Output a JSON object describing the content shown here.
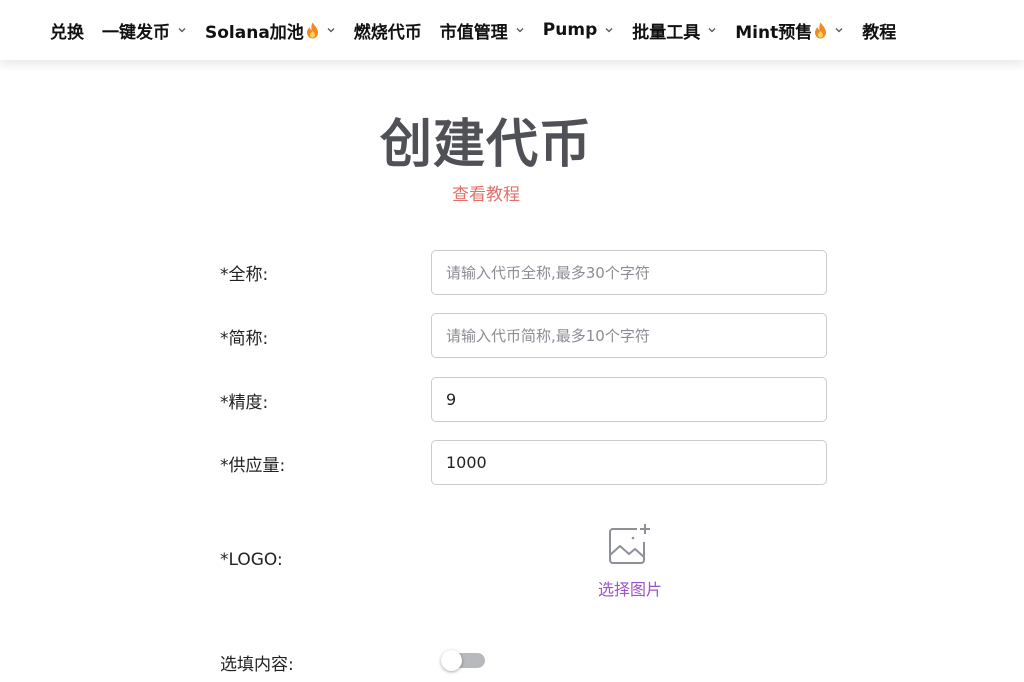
{
  "nav": {
    "items": [
      {
        "label": "兑换",
        "dropdown": false,
        "hot": false
      },
      {
        "label": "一键发币",
        "dropdown": true,
        "hot": false
      },
      {
        "label": "Solana加池",
        "dropdown": true,
        "hot": true
      },
      {
        "label": "燃烧代币",
        "dropdown": false,
        "hot": false
      },
      {
        "label": "市值管理",
        "dropdown": true,
        "hot": false
      },
      {
        "label": "Pump",
        "dropdown": true,
        "hot": false
      },
      {
        "label": "批量工具",
        "dropdown": true,
        "hot": false
      },
      {
        "label": "Mint预售",
        "dropdown": true,
        "hot": true
      },
      {
        "label": "教程",
        "dropdown": false,
        "hot": false
      }
    ],
    "hot_icon": "fire-icon",
    "dropdown_icon": "chevron-down-icon"
  },
  "page": {
    "title": "创建代币",
    "tutorial_link": "查看教程"
  },
  "form": {
    "name": {
      "label": "*全称:",
      "value": "",
      "placeholder": "请输入代币全称,最多30个字符"
    },
    "symbol": {
      "label": "*简称:",
      "value": "",
      "placeholder": "请输入代币简称,最多10个字符"
    },
    "decimals": {
      "label": "*精度:",
      "value": "9",
      "placeholder": ""
    },
    "supply": {
      "label": "*供应量:",
      "value": "1000",
      "placeholder": ""
    },
    "logo": {
      "label": "*LOGO:",
      "upload_label": "选择图片",
      "icon": "image-add-icon"
    },
    "optional": {
      "label": "选填内容:",
      "enabled": false
    }
  },
  "colors": {
    "title": "#4f5156",
    "link": "#e2706a",
    "upload_text": "#9b55c9",
    "toggle_track": "#b8b9bd",
    "fire_outer": "#f08a24",
    "fire_inner": "#fbd15b"
  }
}
